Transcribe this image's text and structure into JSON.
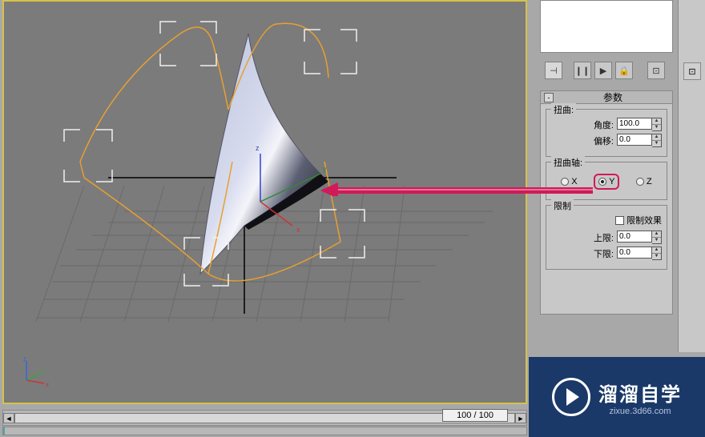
{
  "preview": {},
  "toolbar": {
    "pin": "⊣",
    "prev": "❙❙",
    "play": "▶",
    "lock": "🔒",
    "obj": "⊡"
  },
  "rollout": {
    "collapse": "-",
    "title": "参数",
    "twist": {
      "label": "扭曲:",
      "angle_label": "角度:",
      "angle_value": "100.0",
      "bias_label": "偏移:",
      "bias_value": "0.0"
    },
    "axis": {
      "label": "扭曲轴:",
      "x": "X",
      "y": "Y",
      "z": "Z"
    },
    "limit": {
      "label": "限制",
      "enable_label": "限制效果",
      "upper_label": "上限:",
      "upper_value": "0.0",
      "lower_label": "下限:",
      "lower_value": "0.0"
    }
  },
  "timeline": {
    "left": "◄",
    "right": "►",
    "frame": "100 / 100"
  },
  "watermark": {
    "title": "溜溜自学",
    "url": "zixue.3d66.com"
  }
}
